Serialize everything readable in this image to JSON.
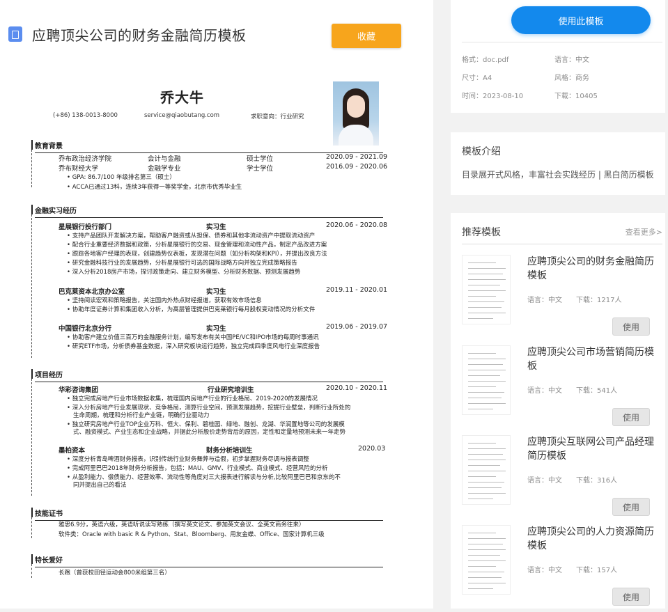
{
  "header": {
    "title": "应聘顶尖公司的财务金融简历模板",
    "favorite_label": "收藏"
  },
  "resume": {
    "name": "乔大牛",
    "phone": "(+86) 138-0013-8000",
    "email": "service@qiaobutang.com",
    "intent": "求职意向：行业研究",
    "education": {
      "title": "教育背景",
      "rows": [
        {
          "school": "乔布政治经济学院",
          "major": "会计与金融",
          "degree": "硕士学位",
          "date": "2020.09 - 2021.09"
        },
        {
          "school": "乔布财经大学",
          "major": "金融学专业",
          "degree": "学士学位",
          "date": "2016.09 - 2020.06"
        }
      ],
      "bullets": [
        "GPA:    86.7/100    年级排名第三（硕士）",
        "ACCA已通过13科，连续3年获得一等奖学金，北京市优秀毕业生"
      ]
    },
    "internship": {
      "title": "金融实习经历",
      "jobs": [
        {
          "company": "星展银行投行部门",
          "role": "实习生",
          "date": "2020.06 - 2020.08",
          "bullets": [
            "支持产品团队开发解决方案，帮助客户融资或从担保、债券和其他非流动资产中提取流动资产",
            "配合行业重要经济数据和政策，分析星展银行的交易、现金管理和流动性产品，制定产品改进方案",
            "跟踪各地客户经理的表现，创建趋势仪表板，发现潜在问题（如分析构架和KPI），并提出改良方法",
            "研究金融科技行业的发展趋势，分析星展银行可选的国际战略方向并独立完成策略报告",
            "深入分析2018房产市场，探讨政策走向、建立财务模型、分析财务数据、预测发展趋势"
          ]
        },
        {
          "company": "巴克莱资本北京办公室",
          "role": "实习生",
          "date": "2019.11 - 2020.01",
          "bullets": [
            "坚持阅读宏观和策略报告，关注国内外热点财经报道，获取有效市场信息",
            "协助年度证券计算和集团收入分析，为高层管理提供巴克莱银行每月股权变动情况的分析文件"
          ]
        },
        {
          "company": "中国银行北京分行",
          "role": "实习生",
          "date": "2019.06 - 2019.07",
          "bullets": [
            "协助客户建立价值三百万的金融服务计划，编写发布有关中国PE/VC和IPO市场的每周时事通讯",
            "研究ETF市场，分析债券基金数据，深入研究板块运行趋势，独立完成四季度风电行业深度报告"
          ]
        }
      ]
    },
    "projects": {
      "title": "项目经历",
      "items": [
        {
          "company": "华彩咨询集团",
          "role": "行业研究培训生",
          "date": "2020.10 - 2020.11",
          "bullets": [
            "独立完成房地产行业市场数据收集，梳理国内房地产行业的行业格局、2019-2020的发展情况",
            "深入分析房地产行业发展现状、竞争格局，测算行业空间，预测发展趋势，挖掘行业壁垒，判断行业所处的",
            "生命周期，梳理和分析行业产业链，明确行业驱动力",
            "独立研究房地产行业TOP企业万科、恒大、保利、碧桂园、绿地、融创、龙湖、华润置地等公司的发展模",
            "式、融资模式、产业生态和企业战略，并据此分析股价走势背后的原因，定性和定量地预测未来一年走势"
          ]
        },
        {
          "company": "墨柏资本",
          "role": "财务分析培训生",
          "date": "2020.03",
          "bullets": [
            "深度分析青岛啤酒财务报表，识别传统行业财务舞弊与造假，初步掌握财务尽调与报表调整",
            "完成阿里巴巴2018年财务分析报告，包括：MAU、GMV、行业模式、商业模式、经营风险的分析",
            "从盈利能力、偿债能力、经营效率、流动性等角度对三大报表进行解读与分析,比较阿里巴巴和京东的不",
            "同并提出自己的看法"
          ]
        }
      ]
    },
    "skills": {
      "title": "技能证书",
      "lines": [
        "雅思6.9分，英语六级，英语听说读写熟练（撰写英文论文、参加英文会议、全英文商务往来）",
        "软件类：Oracle with basic R & Python、Stat、Bloomberg、用友金蝶、Office、国家计算机三级"
      ]
    },
    "hobbies": {
      "title": "特长爱好",
      "lines": [
        "长跑（曾获校田径运动会800米组第三名）"
      ]
    }
  },
  "side": {
    "use_label": "使用此模板",
    "meta": {
      "format": "格式：doc.pdf",
      "language": "语言：中文",
      "size": "尺寸：A4",
      "style": "风格：商务",
      "time": "时间：2023-08-10",
      "downloads": "下载：10405"
    },
    "intro": {
      "title": "模板介绍",
      "text": "目录展开式风格，丰富社会实践经历 | 黑白简历模板"
    },
    "recommend": {
      "title": "推荐模板",
      "more": "查看更多>",
      "items": [
        {
          "title": "应聘顶尖公司的财务金融简历模板",
          "language": "语言：中文",
          "downloads": "下载：1217人",
          "button": "使用"
        },
        {
          "title": "应聘顶尖公司市场营销简历模板",
          "language": "语言：中文",
          "downloads": "下载：541人",
          "button": "使用"
        },
        {
          "title": "应聘顶尖互联网公司产品经理简历模板",
          "language": "语言：中文",
          "downloads": "下载：316人",
          "button": "使用"
        },
        {
          "title": "应聘顶尖公司的人力资源简历模板",
          "language": "语言：中文",
          "downloads": "下载：157人",
          "button": "使用"
        }
      ]
    }
  },
  "colors": {
    "primary": "#1389ed",
    "favorite": "#f7a51c",
    "doc_icon": "#5b8def"
  }
}
